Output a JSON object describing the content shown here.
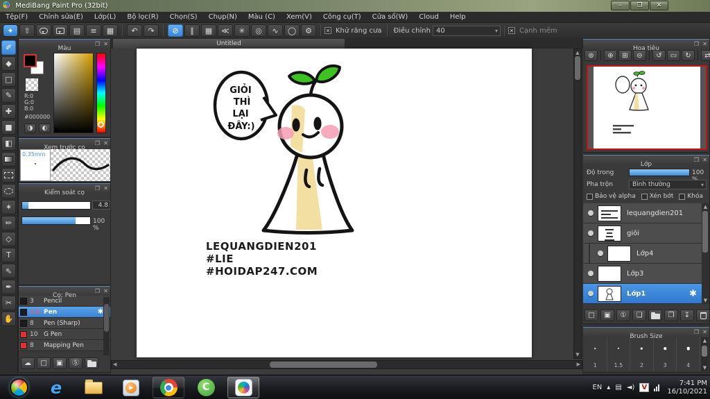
{
  "window": {
    "title": "MediBang Paint Pro (32bit)"
  },
  "icons": {
    "minimize": "–",
    "restore": "❐",
    "close": "✕",
    "popout": "❐",
    "panel_close": "✕",
    "home": "✦",
    "upload": "⇧",
    "doc": "▤",
    "list": "≡",
    "tiles": "▦",
    "undo": "↶",
    "redo": "↷",
    "snap_off": "⊘",
    "snap_parallel": "∥",
    "snap_grid": "▦",
    "snap_vanish": "≪",
    "snap_radial": "✳",
    "snap_circle": "◎",
    "snap_curve": "∿",
    "snap_ellipse": "◯",
    "snap_settings": "⚙",
    "checkbox_x": "✕",
    "dropdown_arrow": "▾",
    "tool_brush": "✐",
    "tool_eraser": "◆",
    "tool_shape": "□",
    "tool_ctrlpen": "✎",
    "tool_move": "✚",
    "tool_fillrect": "■",
    "tool_bucket": "◧",
    "tool_wand": "✶",
    "tool_selpen": "✏",
    "tool_seleraser": "◇",
    "tool_text": "T",
    "tool_operate": "⇖",
    "tool_eyedrop": "✒",
    "tool_divide": "✂",
    "tool_hand": "✋",
    "nav_zoom_tool": "⊚",
    "nav_zoom_in": "⊕",
    "nav_fit": "⊞",
    "nav_zoom_out": "⊖",
    "nav_rot_left": "↺",
    "nav_fit_w": "▭",
    "nav_rot_right": "↻",
    "nav_flip": "⇄",
    "brush_cloud": "☁",
    "brush_new": "□",
    "brush_new_dd": "▣",
    "brush_script": "Ⓢ",
    "layer_new": "□",
    "layer_8bit": "▣",
    "layer_1bit": "①",
    "layer_folder_add": "❏",
    "layer_dup": "❐",
    "layer_merge": "↧",
    "gear": "✱",
    "up": "▲",
    "down": "▼",
    "left": "◀",
    "right": "▶",
    "tray_up": "▴",
    "tray_action": "▤",
    "tray_speaker": "◄)",
    "tray_v": "V",
    "wmp_play": "▶",
    "coccoc": "C",
    "ie": "e"
  },
  "menu": {
    "items": [
      "Tệp(F)",
      "Chỉnh sửa(E)",
      "Lớp(L)",
      "Bộ lọc(R)",
      "Chọn(S)",
      "Chụp(N)",
      "Màu (C)",
      "Xem(V)",
      "Công cụ(T)",
      "Cửa sổ(W)",
      "Cloud",
      "Help"
    ]
  },
  "toolbar": {
    "antialias": "Khử răng cưa",
    "adjust": "Điều chỉnh",
    "adjust_value": "40",
    "soft_edge": "Cạnh mềm"
  },
  "color_panel": {
    "title": "Màu",
    "r": "R:0",
    "g": "G:0",
    "b": "B:0",
    "hex": "#000000"
  },
  "preview_panel": {
    "title": "Xem trước cọ",
    "size": "0.35mm"
  },
  "control_panel": {
    "title": "Kiểm soát cọ",
    "width_value": "4.8",
    "opacity_value": "100 %"
  },
  "brush_panel": {
    "title": "Cọ: Pen",
    "brushes": [
      {
        "size": "3",
        "name": "Pencil"
      },
      {
        "size": "4.8",
        "name": "Pen"
      },
      {
        "size": "8",
        "name": "Pen (Sharp)"
      },
      {
        "size": "10",
        "name": "G Pen"
      },
      {
        "size": "8",
        "name": "Mapping Pen"
      }
    ]
  },
  "canvas": {
    "tab": "Untitled",
    "speech": [
      "GIỎI",
      "THÌ",
      "LẠI",
      "ĐÂY:)"
    ],
    "caption": [
      "LEQUANGDIEN201",
      "#LIE",
      "#HOIDAP247.COM"
    ]
  },
  "navigator": {
    "title": "Hoa tiêu"
  },
  "layers_panel": {
    "title": "Lớp",
    "opacity_label": "Độ trong",
    "opacity_value": "100 %",
    "blend_label": "Pha trộn",
    "blend_value": "Bình thường",
    "cb_alpha": "Bảo vệ alpha",
    "cb_clip": "Xén bớt",
    "cb_lock": "Khóa",
    "items": [
      {
        "name": "lequangdien201"
      },
      {
        "name": "giỏi"
      },
      {
        "name": "Lớp4"
      },
      {
        "name": "Lớp3"
      },
      {
        "name": "Lớp1"
      }
    ]
  },
  "brush_size_panel": {
    "title": "Brush Size",
    "sizes": [
      "1",
      "1.5",
      "2",
      "3",
      "4"
    ]
  },
  "taskbar": {
    "lang": "EN",
    "time": "7:41 PM",
    "date": "16/10/2021"
  },
  "colors": {
    "accent": "#4a9ae8",
    "selection": "#3d84d8",
    "canvas_bg": "#3c3c3c",
    "fg_color": "#000000"
  }
}
